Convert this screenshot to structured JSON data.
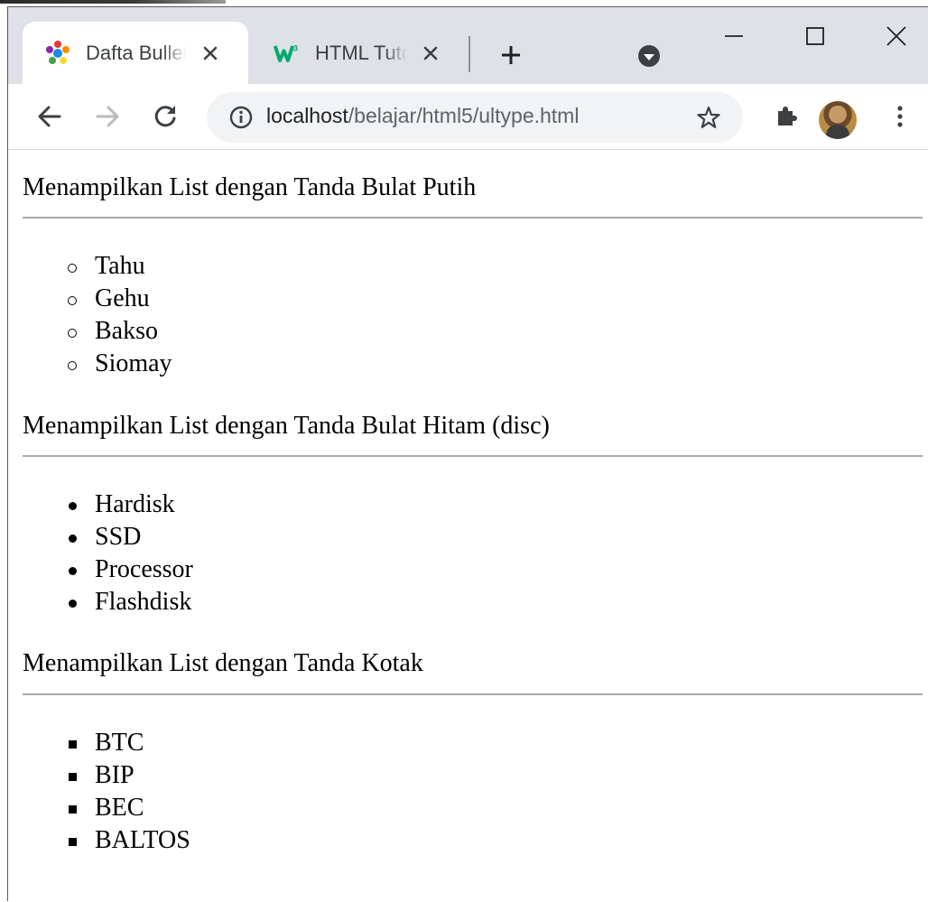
{
  "browser": {
    "tabs": [
      {
        "title": "Dafta Bullet",
        "favicon": "colorful-star-icon",
        "active": true
      },
      {
        "title": "HTML Tuto",
        "favicon": "w3schools-icon",
        "active": false
      }
    ],
    "new_tab_label": "+",
    "url": {
      "host": "localhost",
      "path": "/belajar/html5/ultype.html"
    },
    "colors": {
      "tabbar": "#dee1e6",
      "omnibox": "#f1f3f4",
      "w3_green": "#04aa6d"
    }
  },
  "page": {
    "sections": [
      {
        "title": "Menampilkan List dengan Tanda Bulat Putih",
        "bullet": "circle",
        "items": [
          "Tahu",
          "Gehu",
          "Bakso",
          "Siomay"
        ]
      },
      {
        "title": "Menampilkan List dengan Tanda Bulat Hitam (disc)",
        "bullet": "disc",
        "items": [
          "Hardisk",
          "SSD",
          "Processor",
          "Flashdisk"
        ]
      },
      {
        "title": "Menampilkan List dengan Tanda Kotak",
        "bullet": "square",
        "items": [
          "BTC",
          "BIP",
          "BEC",
          "BALTOS"
        ]
      }
    ]
  }
}
